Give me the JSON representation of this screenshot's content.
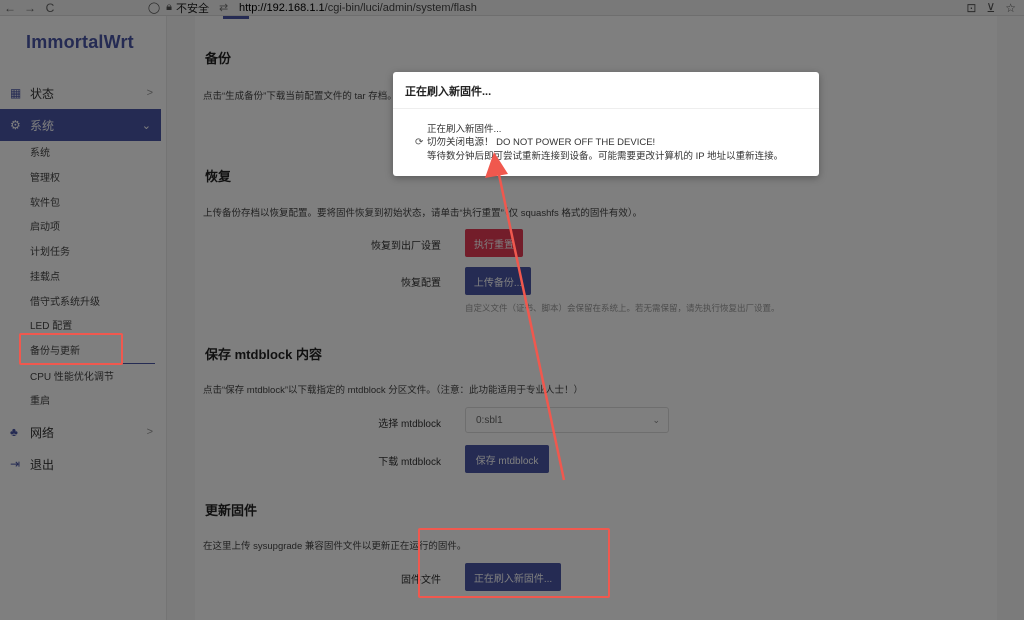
{
  "browser": {
    "back": "←",
    "forward": "→",
    "reload": "C",
    "insecure_label": "不安全",
    "url_host": "http://192.168.1.1",
    "url_path": "/cgi-bin/luci/admin/system/flash"
  },
  "sidebar": {
    "logo": "ImmortalWrt",
    "status": "状态",
    "system": "系统",
    "system_items": [
      "系统",
      "管理权",
      "软件包",
      "启动项",
      "计划任务",
      "挂载点",
      "借守式系统升级",
      "LED 配置",
      "备份与更新",
      "CPU 性能优化调节",
      "重启"
    ],
    "network": "网络",
    "logout": "退出"
  },
  "backup": {
    "title": "备份",
    "desc": "点击“生成备份”下载当前配置文件的 tar 存档。"
  },
  "restore": {
    "title": "恢复",
    "desc": "上传备份存档以恢复配置。要将固件恢复到初始状态，请单击“执行重置”（仅 squashfs 格式的固件有效）。",
    "factory_label": "恢复到出厂设置",
    "factory_button": "执行重置",
    "restore_label": "恢复配置",
    "restore_button": "上传备份...",
    "hint": "自定义文件（证书、脚本）会保留在系统上。若无需保留，请先执行恢复出厂设置。"
  },
  "mtd": {
    "title": "保存 mtdblock 内容",
    "desc": "点击“保存 mtdblock”以下载指定的 mtdblock 分区文件。（注意：此功能适用于专业人士！）",
    "select_label": "选择 mtdblock",
    "select_value": "0:sbl1",
    "download_label": "下载 mtdblock",
    "download_button": "保存 mtdblock"
  },
  "flash": {
    "title": "更新固件",
    "desc": "在这里上传 sysupgrade 兼容固件文件以更新正在运行的固件。",
    "image_label": "固件文件",
    "image_button": "正在刷入新固件..."
  },
  "modal": {
    "title": "正在刷入新固件...",
    "line1": "正在刷入新固件...",
    "line2": "切勿关闭电源！ DO NOT POWER OFF THE DEVICE!",
    "line3": "等待数分钟后即可尝试重新连接到设备。可能需要更改计算机的 IP 地址以重新连接。"
  },
  "colors": {
    "accent": "#4a56a6",
    "danger": "#e63a55",
    "annotation": "#f0584e"
  }
}
